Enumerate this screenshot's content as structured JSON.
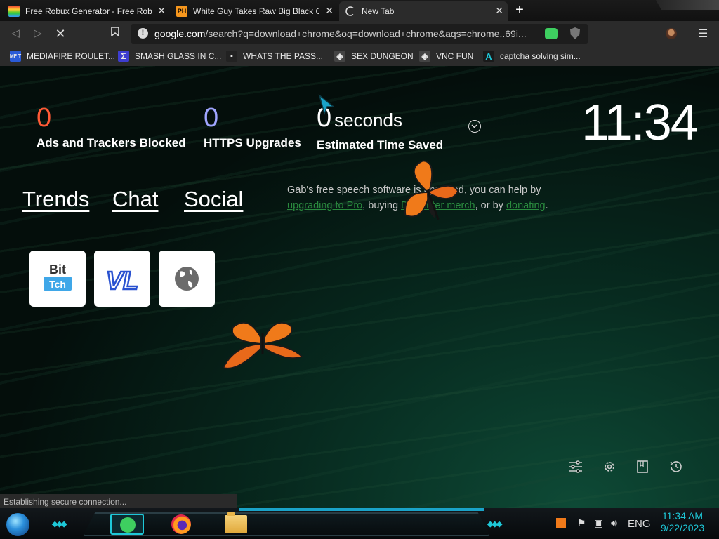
{
  "browser": {
    "tabs": [
      {
        "title": "Free Robux Generator - Free Robux",
        "favicon": "rainbow-favicon",
        "active": false
      },
      {
        "title": "White Guy Takes Raw Big Black Co",
        "favicon": "ph-favicon",
        "favicon_text": "PH",
        "active": false
      },
      {
        "title": "New Tab",
        "favicon": "loading-spinner",
        "active": true
      }
    ],
    "new_tab_label": "+",
    "tab_close_glyph": "✕",
    "url_host": "google.com",
    "url_rest": "/search?q=download+chrome&oq=download+chrome&aqs=chrome..69i...",
    "bookmarks": [
      {
        "label": "MEDIAFIRE ROULET...",
        "icon": "mf-icon",
        "icon_text": "MF T",
        "icon_color": "#2a5bd7"
      },
      {
        "label": "SMASH GLASS IN C...",
        "icon": "sigma-icon",
        "icon_text": "Σ",
        "icon_color": "#3d3dd0"
      },
      {
        "label": "WHATS THE PASS...",
        "icon": "lock-icon",
        "icon_text": "▪",
        "icon_color": "#222"
      },
      {
        "label": "SEX DUNGEON",
        "icon": "cube-icon",
        "icon_text": "◈",
        "icon_color": "#444"
      },
      {
        "label": "VNC FUN",
        "icon": "gear-cube-icon",
        "icon_text": "◈",
        "icon_color": "#444"
      },
      {
        "label": "captcha solving sim...",
        "icon": "a-icon",
        "icon_text": "A",
        "icon_color": "#1a1a1a"
      }
    ]
  },
  "newtab": {
    "stats": [
      {
        "value": "0",
        "label": "Ads and Trackers Blocked",
        "color": "#ff5a36"
      },
      {
        "value": "0",
        "label": "HTTPS Upgrades",
        "color": "#a0a5ff"
      },
      {
        "value": "0",
        "unit": "seconds",
        "label": "Estimated Time Saved",
        "color": "#ffffff"
      }
    ],
    "clock": "11:34",
    "links": [
      "Trends",
      "Chat",
      "Social"
    ],
    "gab_text_1": "Gab's free speech software is ",
    "gab_text_2": "upported, you can help by ",
    "gab_link_1": "upgrading to Pro",
    "gab_text_3": ", buying ",
    "gab_link_2": "Dissenter merch",
    "gab_text_4": ", or by ",
    "gab_link_3": "donating",
    "gab_text_5": ".",
    "tiles": [
      {
        "name": "bitchute-tile",
        "text": "Bit"
      },
      {
        "name": "vl-tile",
        "text": "VL"
      },
      {
        "name": "globe-tile",
        "text": ""
      }
    ]
  },
  "status_text": "Establishing secure connection...",
  "taskbar": {
    "language": "ENG",
    "time": "11:34 AM",
    "date": "9/22/2023"
  },
  "colors": {
    "accent_cyan": "#1ec8d8",
    "link_green": "#2a8a3e"
  }
}
